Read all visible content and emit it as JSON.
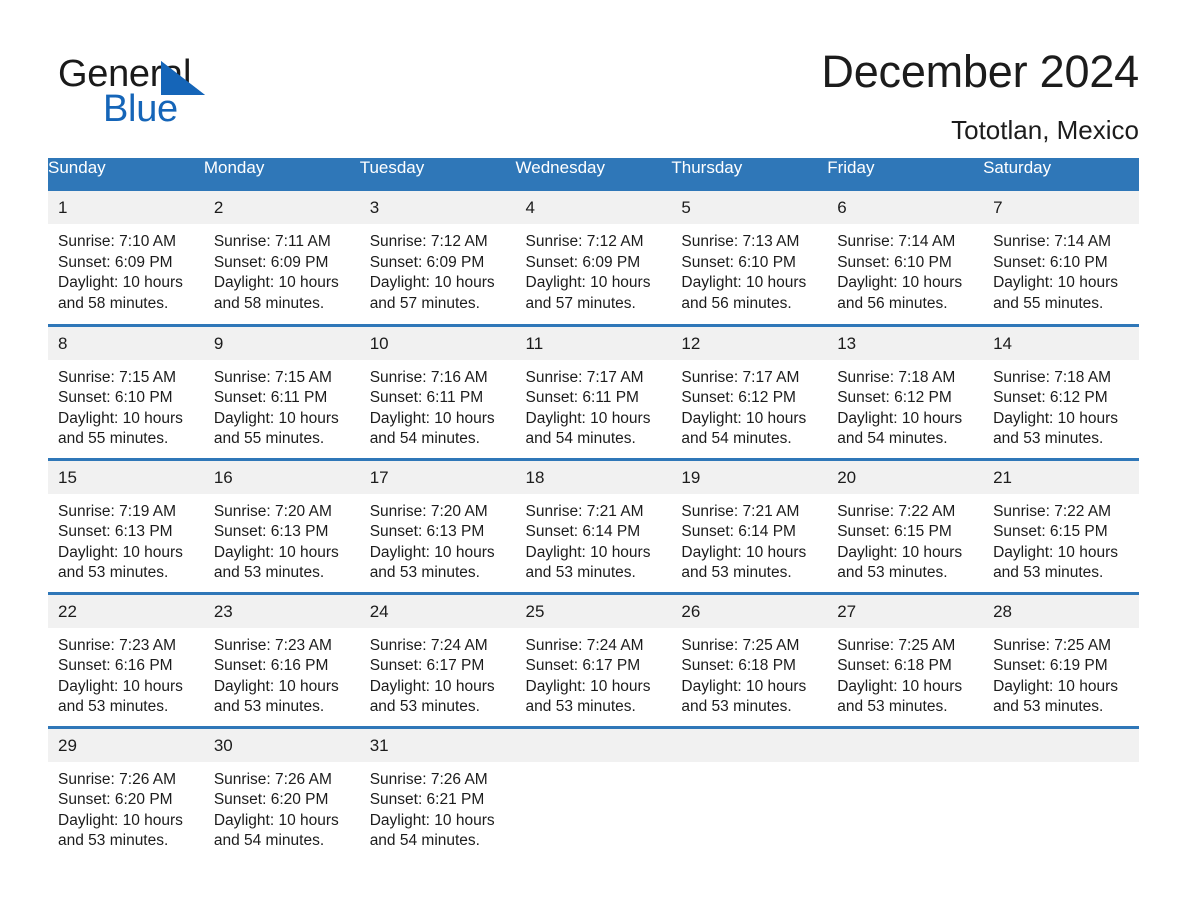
{
  "brand": {
    "word_one": "General",
    "word_two": "Blue",
    "triangle_icon": "triangle-logo-icon",
    "accent_color": "#1565b8"
  },
  "header": {
    "title": "December 2024",
    "location": "Tototlan, Mexico"
  },
  "theme": {
    "header_blue": "#2f77b8",
    "daynum_band": "#f1f1f1",
    "text": "#1c1c1c",
    "cell_bg": "#ffffff"
  },
  "weekday_headers": [
    "Sunday",
    "Monday",
    "Tuesday",
    "Wednesday",
    "Thursday",
    "Friday",
    "Saturday"
  ],
  "weeks": [
    [
      {
        "day": "1",
        "sunrise": "Sunrise: 7:10 AM",
        "sunset": "Sunset: 6:09 PM",
        "daylight_line1": "Daylight: 10 hours",
        "daylight_line2": "and 58 minutes."
      },
      {
        "day": "2",
        "sunrise": "Sunrise: 7:11 AM",
        "sunset": "Sunset: 6:09 PM",
        "daylight_line1": "Daylight: 10 hours",
        "daylight_line2": "and 58 minutes."
      },
      {
        "day": "3",
        "sunrise": "Sunrise: 7:12 AM",
        "sunset": "Sunset: 6:09 PM",
        "daylight_line1": "Daylight: 10 hours",
        "daylight_line2": "and 57 minutes."
      },
      {
        "day": "4",
        "sunrise": "Sunrise: 7:12 AM",
        "sunset": "Sunset: 6:09 PM",
        "daylight_line1": "Daylight: 10 hours",
        "daylight_line2": "and 57 minutes."
      },
      {
        "day": "5",
        "sunrise": "Sunrise: 7:13 AM",
        "sunset": "Sunset: 6:10 PM",
        "daylight_line1": "Daylight: 10 hours",
        "daylight_line2": "and 56 minutes."
      },
      {
        "day": "6",
        "sunrise": "Sunrise: 7:14 AM",
        "sunset": "Sunset: 6:10 PM",
        "daylight_line1": "Daylight: 10 hours",
        "daylight_line2": "and 56 minutes."
      },
      {
        "day": "7",
        "sunrise": "Sunrise: 7:14 AM",
        "sunset": "Sunset: 6:10 PM",
        "daylight_line1": "Daylight: 10 hours",
        "daylight_line2": "and 55 minutes."
      }
    ],
    [
      {
        "day": "8",
        "sunrise": "Sunrise: 7:15 AM",
        "sunset": "Sunset: 6:10 PM",
        "daylight_line1": "Daylight: 10 hours",
        "daylight_line2": "and 55 minutes."
      },
      {
        "day": "9",
        "sunrise": "Sunrise: 7:15 AM",
        "sunset": "Sunset: 6:11 PM",
        "daylight_line1": "Daylight: 10 hours",
        "daylight_line2": "and 55 minutes."
      },
      {
        "day": "10",
        "sunrise": "Sunrise: 7:16 AM",
        "sunset": "Sunset: 6:11 PM",
        "daylight_line1": "Daylight: 10 hours",
        "daylight_line2": "and 54 minutes."
      },
      {
        "day": "11",
        "sunrise": "Sunrise: 7:17 AM",
        "sunset": "Sunset: 6:11 PM",
        "daylight_line1": "Daylight: 10 hours",
        "daylight_line2": "and 54 minutes."
      },
      {
        "day": "12",
        "sunrise": "Sunrise: 7:17 AM",
        "sunset": "Sunset: 6:12 PM",
        "daylight_line1": "Daylight: 10 hours",
        "daylight_line2": "and 54 minutes."
      },
      {
        "day": "13",
        "sunrise": "Sunrise: 7:18 AM",
        "sunset": "Sunset: 6:12 PM",
        "daylight_line1": "Daylight: 10 hours",
        "daylight_line2": "and 54 minutes."
      },
      {
        "day": "14",
        "sunrise": "Sunrise: 7:18 AM",
        "sunset": "Sunset: 6:12 PM",
        "daylight_line1": "Daylight: 10 hours",
        "daylight_line2": "and 53 minutes."
      }
    ],
    [
      {
        "day": "15",
        "sunrise": "Sunrise: 7:19 AM",
        "sunset": "Sunset: 6:13 PM",
        "daylight_line1": "Daylight: 10 hours",
        "daylight_line2": "and 53 minutes."
      },
      {
        "day": "16",
        "sunrise": "Sunrise: 7:20 AM",
        "sunset": "Sunset: 6:13 PM",
        "daylight_line1": "Daylight: 10 hours",
        "daylight_line2": "and 53 minutes."
      },
      {
        "day": "17",
        "sunrise": "Sunrise: 7:20 AM",
        "sunset": "Sunset: 6:13 PM",
        "daylight_line1": "Daylight: 10 hours",
        "daylight_line2": "and 53 minutes."
      },
      {
        "day": "18",
        "sunrise": "Sunrise: 7:21 AM",
        "sunset": "Sunset: 6:14 PM",
        "daylight_line1": "Daylight: 10 hours",
        "daylight_line2": "and 53 minutes."
      },
      {
        "day": "19",
        "sunrise": "Sunrise: 7:21 AM",
        "sunset": "Sunset: 6:14 PM",
        "daylight_line1": "Daylight: 10 hours",
        "daylight_line2": "and 53 minutes."
      },
      {
        "day": "20",
        "sunrise": "Sunrise: 7:22 AM",
        "sunset": "Sunset: 6:15 PM",
        "daylight_line1": "Daylight: 10 hours",
        "daylight_line2": "and 53 minutes."
      },
      {
        "day": "21",
        "sunrise": "Sunrise: 7:22 AM",
        "sunset": "Sunset: 6:15 PM",
        "daylight_line1": "Daylight: 10 hours",
        "daylight_line2": "and 53 minutes."
      }
    ],
    [
      {
        "day": "22",
        "sunrise": "Sunrise: 7:23 AM",
        "sunset": "Sunset: 6:16 PM",
        "daylight_line1": "Daylight: 10 hours",
        "daylight_line2": "and 53 minutes."
      },
      {
        "day": "23",
        "sunrise": "Sunrise: 7:23 AM",
        "sunset": "Sunset: 6:16 PM",
        "daylight_line1": "Daylight: 10 hours",
        "daylight_line2": "and 53 minutes."
      },
      {
        "day": "24",
        "sunrise": "Sunrise: 7:24 AM",
        "sunset": "Sunset: 6:17 PM",
        "daylight_line1": "Daylight: 10 hours",
        "daylight_line2": "and 53 minutes."
      },
      {
        "day": "25",
        "sunrise": "Sunrise: 7:24 AM",
        "sunset": "Sunset: 6:17 PM",
        "daylight_line1": "Daylight: 10 hours",
        "daylight_line2": "and 53 minutes."
      },
      {
        "day": "26",
        "sunrise": "Sunrise: 7:25 AM",
        "sunset": "Sunset: 6:18 PM",
        "daylight_line1": "Daylight: 10 hours",
        "daylight_line2": "and 53 minutes."
      },
      {
        "day": "27",
        "sunrise": "Sunrise: 7:25 AM",
        "sunset": "Sunset: 6:18 PM",
        "daylight_line1": "Daylight: 10 hours",
        "daylight_line2": "and 53 minutes."
      },
      {
        "day": "28",
        "sunrise": "Sunrise: 7:25 AM",
        "sunset": "Sunset: 6:19 PM",
        "daylight_line1": "Daylight: 10 hours",
        "daylight_line2": "and 53 minutes."
      }
    ],
    [
      {
        "day": "29",
        "sunrise": "Sunrise: 7:26 AM",
        "sunset": "Sunset: 6:20 PM",
        "daylight_line1": "Daylight: 10 hours",
        "daylight_line2": "and 53 minutes."
      },
      {
        "day": "30",
        "sunrise": "Sunrise: 7:26 AM",
        "sunset": "Sunset: 6:20 PM",
        "daylight_line1": "Daylight: 10 hours",
        "daylight_line2": "and 54 minutes."
      },
      {
        "day": "31",
        "sunrise": "Sunrise: 7:26 AM",
        "sunset": "Sunset: 6:21 PM",
        "daylight_line1": "Daylight: 10 hours",
        "daylight_line2": "and 54 minutes."
      },
      {
        "day": "",
        "sunrise": "",
        "sunset": "",
        "daylight_line1": "",
        "daylight_line2": ""
      },
      {
        "day": "",
        "sunrise": "",
        "sunset": "",
        "daylight_line1": "",
        "daylight_line2": ""
      },
      {
        "day": "",
        "sunrise": "",
        "sunset": "",
        "daylight_line1": "",
        "daylight_line2": ""
      },
      {
        "day": "",
        "sunrise": "",
        "sunset": "",
        "daylight_line1": "",
        "daylight_line2": ""
      }
    ]
  ]
}
